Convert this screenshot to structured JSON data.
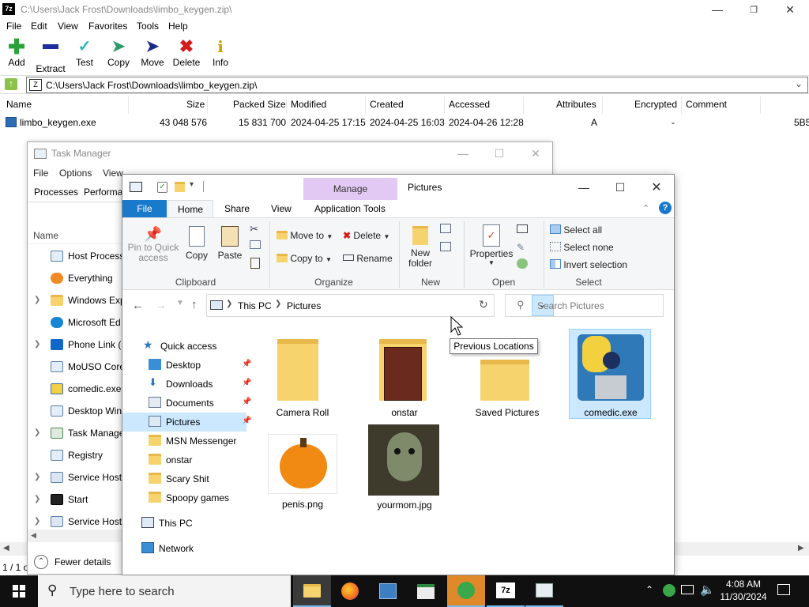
{
  "sevenzip": {
    "title": "C:\\Users\\Jack Frost\\Downloads\\limbo_keygen.zip\\",
    "menu": [
      "File",
      "Edit",
      "View",
      "Favorites",
      "Tools",
      "Help"
    ],
    "toolbar": [
      "Add",
      "Extract",
      "Test",
      "Copy",
      "Move",
      "Delete",
      "Info"
    ],
    "address": "C:\\Users\\Jack Frost\\Downloads\\limbo_keygen.zip\\",
    "columns": [
      "Name",
      "Size",
      "Packed Size",
      "Modified",
      "Created",
      "Accessed",
      "Attributes",
      "Encrypted",
      "Comment"
    ],
    "row": {
      "name": "limbo_keygen.exe",
      "size": "43 048 576",
      "packed": "15 831 700",
      "modified": "2024-04-25 17:15",
      "created": "2024-04-25 16:03",
      "accessed": "2024-04-26 12:28",
      "attributes": "A",
      "encrypted": "-",
      "trailing": "5B5"
    },
    "status": "1 / 1 o"
  },
  "taskmgr": {
    "title": "Task Manager",
    "menu": [
      "File",
      "Options",
      "View"
    ],
    "tabs": [
      "Processes",
      "Performa"
    ],
    "col_name": "Name",
    "items": [
      {
        "label": "Host Process",
        "chev": false
      },
      {
        "label": "Everything",
        "chev": false
      },
      {
        "label": "Windows Exp",
        "chev": true
      },
      {
        "label": "Microsoft Ed",
        "chev": false
      },
      {
        "label": "Phone Link (",
        "chev": true
      },
      {
        "label": "MoUSO Core",
        "chev": false
      },
      {
        "label": "comedic.exe",
        "chev": false
      },
      {
        "label": "Desktop Win",
        "chev": false
      },
      {
        "label": "Task Manage",
        "chev": true
      },
      {
        "label": "Registry",
        "chev": false
      },
      {
        "label": "Service Host:",
        "chev": true
      },
      {
        "label": "Start",
        "chev": true
      },
      {
        "label": "Service Host:",
        "chev": true
      }
    ],
    "fewer_details": "Fewer details"
  },
  "explorer": {
    "manage_label": "Manage",
    "title": "Pictures",
    "tabs": {
      "file": "File",
      "home": "Home",
      "share": "Share",
      "view": "View",
      "app_tools": "Application Tools"
    },
    "ribbon": {
      "pin_to_quick_access": "Pin to Quick access",
      "copy": "Copy",
      "paste": "Paste",
      "move_to": "Move to",
      "copy_to": "Copy to",
      "delete": "Delete",
      "rename": "Rename",
      "new_folder": "New folder",
      "properties": "Properties",
      "select_all": "Select all",
      "select_none": "Select none",
      "invert_selection": "Invert selection",
      "groups": {
        "clipboard": "Clipboard",
        "organize": "Organize",
        "new": "New",
        "open": "Open",
        "select": "Select"
      }
    },
    "breadcrumb": [
      "This PC",
      "Pictures"
    ],
    "search_placeholder": "Search Pictures",
    "tooltip": "Previous Locations",
    "nav": {
      "quick_access": "Quick access",
      "pinned": [
        "Desktop",
        "Downloads",
        "Documents",
        "Pictures"
      ],
      "folders": [
        "MSN Messenger",
        "onstar",
        "Scary Shit",
        "Spoopy games"
      ],
      "this_pc": "This PC",
      "network": "Network"
    },
    "files": [
      "Camera Roll",
      "onstar",
      "Saved Pictures",
      "comedic.exe",
      "penis.png",
      "yourmom.jpg"
    ]
  },
  "taskbar": {
    "search_placeholder": "Type here to search",
    "time": "4:08 AM",
    "date": "11/30/2024"
  },
  "icon_colors": {
    "add": "#2aa23a",
    "extract": "#1c2f9c",
    "test": "#29b7b7",
    "copy": "#2a9a6a",
    "move": "#1a2a8a",
    "delete": "#d21c1c",
    "info": "#c9a200"
  }
}
